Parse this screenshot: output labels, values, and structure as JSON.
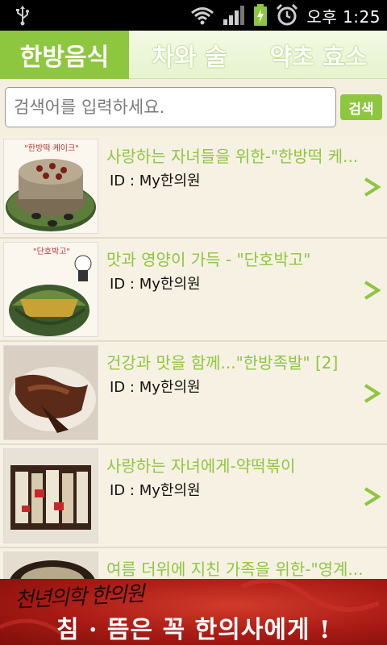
{
  "status_bar": {
    "time": "오후 1:25",
    "icons": [
      "usb-icon",
      "wifi-icon",
      "signal-icon",
      "battery-charging-icon",
      "alarm-icon"
    ]
  },
  "tabs": [
    {
      "label": "한방음식",
      "active": true
    },
    {
      "label": "차와 술",
      "active": false
    },
    {
      "label": "약초 효소",
      "active": false
    }
  ],
  "search": {
    "placeholder": "검색어를 입력하세요.",
    "button_label": "검색"
  },
  "posts": [
    {
      "title": "사랑하는 자녀들을 위한-\"한방떡 케...",
      "id_label": "ID :",
      "author": "My한의원",
      "thumb_caption": "\"한방떡 케이크\""
    },
    {
      "title": "맛과 영양이 가득 - \"단호박고\"",
      "id_label": "ID :",
      "author": "My한의원",
      "thumb_caption": "\"단호박고\""
    },
    {
      "title": "건강과 맛을 함께...\"한방족발\" [2]",
      "id_label": "ID :",
      "author": "My한의원",
      "thumb_caption": ""
    },
    {
      "title": "사랑하는 자녀에게-약떡볶이",
      "id_label": "ID :",
      "author": "My한의원",
      "thumb_caption": ""
    },
    {
      "title": "여름 더위에 지친 가족을 위한-\"영계...",
      "id_label": "",
      "author": "",
      "thumb_caption": ""
    }
  ],
  "ad": {
    "line1": "천년의학 한의원",
    "line2": "침 · 뜸은 꼭 한의사에게 !"
  },
  "colors": {
    "accent": "#8dc63f",
    "background": "#f7f1e3",
    "ad_red": "#a81a14"
  }
}
